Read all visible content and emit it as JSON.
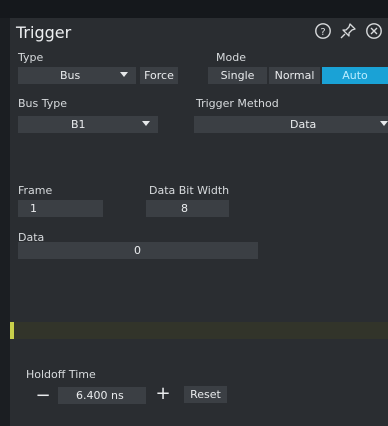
{
  "panel": {
    "title": "Trigger",
    "help_icon": "help-icon",
    "pin_icon": "pin-icon",
    "close_icon": "close-icon"
  },
  "type": {
    "label": "Type",
    "value": "Bus",
    "force_label": "Force"
  },
  "mode": {
    "label": "Mode",
    "options": [
      "Single",
      "Normal",
      "Auto"
    ],
    "selected": "Auto",
    "active_color": "#1aa2d6"
  },
  "bus_type": {
    "label": "Bus Type",
    "value": "B1"
  },
  "trigger_method": {
    "label": "Trigger Method",
    "value": "Data"
  },
  "frame": {
    "label": "Frame",
    "value": "1"
  },
  "data_bit_width": {
    "label": "Data Bit Width",
    "value": "8"
  },
  "data": {
    "label": "Data",
    "value": "0"
  },
  "holdoff": {
    "label": "Holdoff Time",
    "minus": "−",
    "value": "6.400 ns",
    "plus": "+",
    "reset_label": "Reset"
  }
}
